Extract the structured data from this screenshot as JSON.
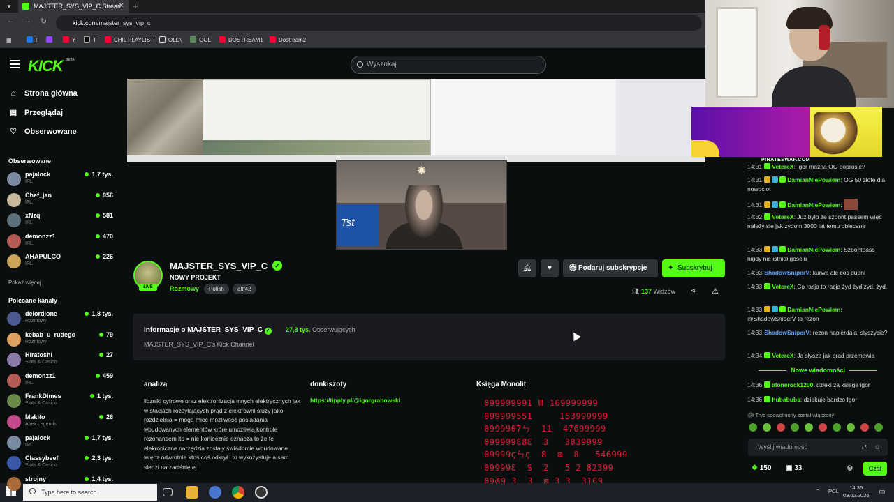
{
  "browser": {
    "tab_title": "MAJSTER_SYS_VIP_C Stream",
    "url_domain": "kick.com",
    "url_path": "/majster_sys_vip_c",
    "bookmarks": [
      "F",
      "",
      "Y",
      "T",
      "CHIL PLAYLIST",
      "OLD\\",
      "GOL",
      "DOSTREAM1",
      "Dostream2"
    ]
  },
  "header": {
    "logo": "KICK",
    "beta": "BETA",
    "search_placeholder": "Wyszukaj"
  },
  "nav": {
    "home": "Strona główna",
    "browse": "Przeglądaj",
    "following": "Obserwowane"
  },
  "sidebar": {
    "following_title": "Obserwowane",
    "show_more": "Pokaż więcej",
    "recommended_title": "Polecane kanały",
    "following": [
      {
        "name": "pajalock",
        "cat": "IRL",
        "viewers": "1,7 tys.",
        "color": "#7a8aa0"
      },
      {
        "name": "Chef_jan",
        "cat": "IRL",
        "viewers": "956",
        "color": "#c9b79a"
      },
      {
        "name": "xNzq",
        "cat": "IRL",
        "viewers": "581",
        "color": "#5d6f7a"
      },
      {
        "name": "demonzz1",
        "cat": "IRL",
        "viewers": "470",
        "color": "#b35b55"
      },
      {
        "name": "AHAPULCO",
        "cat": "IRL",
        "viewers": "226",
        "color": "#caa55a"
      }
    ],
    "recommended": [
      {
        "name": "delordione",
        "cat": "Rozmowy",
        "viewers": "1,8 tys.",
        "color": "#4d5a8f"
      },
      {
        "name": "kebab_u_rudego",
        "cat": "Rozmowy",
        "viewers": "79",
        "color": "#e0a060"
      },
      {
        "name": "Hiratoshi",
        "cat": "Slots & Casino",
        "viewers": "27",
        "color": "#8a7aa8"
      },
      {
        "name": "demonzz1",
        "cat": "IRL",
        "viewers": "459",
        "color": "#b35b55"
      },
      {
        "name": "FrankDimes",
        "cat": "Slots & Casino",
        "viewers": "1 tys.",
        "color": "#6a8a4a"
      },
      {
        "name": "Makito",
        "cat": "Apex Legends",
        "viewers": "26",
        "color": "#c24a8a"
      },
      {
        "name": "pajalock",
        "cat": "IRL",
        "viewers": "1,7 tys.",
        "color": "#7a8aa0"
      },
      {
        "name": "Classybeef",
        "cat": "Slots & Casino",
        "viewers": "2,3 tys.",
        "color": "#3a5aa8"
      },
      {
        "name": "strojny",
        "cat": "",
        "viewers": "1,4 tys.",
        "color": "#aa6a3a"
      }
    ]
  },
  "ad": {
    "label": "PIRATESWAP.COM"
  },
  "channel": {
    "name": "MAJSTER_SYS_VIP_C",
    "live": "LIVE",
    "stream_title": "NOWY PROJEKT",
    "category": "Rozmowy",
    "tags": [
      "Polish",
      "altf42"
    ],
    "gift_label": "Podaruj subskrypcje",
    "subscribe_label": "Subskrybuj",
    "viewers": "137",
    "viewers_label": "Widzów"
  },
  "about": {
    "title": "Informacje o MAJSTER_SYS_VIP_C",
    "followers": "27,3 tys.",
    "followers_label": "Obserwujących",
    "description": "MAJSTER_SYS_VIP_C's Kick Channel"
  },
  "panels": {
    "p1_title": "analiza",
    "p1_text": "liczniki cyfrowe oraz elektronizacja innych elektrycznych jak w stacjach rozsyłających prąd z elektrowni służy jako rozdzielnia = mogą mieć możliwość posiadania wbudowanych elementów króre umożliwią kontrole rezonansem itp = nie koniecznie oznacza to że te elekroniczne narzędzia zostały świadomie wbudowane wręcz odwrotnie ktoś coś odkrył i to wykożystuje a sam siedzi na zaciśniętej",
    "p2_title": "donkiszoty",
    "p2_link": "https://tipply.pl/@igorgrabowski",
    "p3_title": "Księga Monolit",
    "p3_lines": [
      "θ99999991 Ⅲ 169999999",
      "θ99999551     153999999",
      "θ9999θ7ㄣ  11  47699999",
      "θ99999Ɛ8Ɛ  3   3839999",
      "θ9999ϛㄣϛ  8  ⊠  8   546999",
      "θ9999Ɛ  S  2   5 2 82399",
      "θ9ᘔ9 3  3  ⊠ 3 3  3169"
    ]
  },
  "chat": {
    "messages": [
      {
        "t": "14:31",
        "u": "VetereX",
        "c": "g",
        "m": "Igor można OG poprosic?"
      },
      {
        "t": "14:31",
        "u": "DamianNiePowiem",
        "c": "g",
        "m": "OG 50 złote dla nowociot"
      },
      {
        "t": "14:31",
        "u": "DamianNiePowiem",
        "c": "g",
        "m": ""
      },
      {
        "t": "14:32",
        "u": "VetereX",
        "c": "g",
        "m": "Już było że szpont passem więc należy sie jak żydom 3000 lat temu obiecane"
      },
      {
        "t": "14:33",
        "u": "DamianNiePowiem",
        "c": "g",
        "m": "Szpontpass nigdy nie istniał gościu"
      },
      {
        "t": "14:33",
        "u": "ShadowSniperV",
        "c": "b",
        "m": "kurwa ale cos dudni"
      },
      {
        "t": "14:33",
        "u": "VetereX",
        "c": "g",
        "m": "Co racja to racja żyd żyd żyd. żyd."
      },
      {
        "t": "14:33",
        "u": "DamianNiePowiem",
        "c": "g",
        "m": "@ShadowSniperV to rezon"
      },
      {
        "t": "14:33",
        "u": "ShadowSniperV",
        "c": "b",
        "m": "rezon napierdala, slyszycie?"
      },
      {
        "t": "14:34",
        "u": "VetereX",
        "c": "g",
        "m": "Ja slysze jak prad przemawia"
      }
    ],
    "new_messages": "Nowe wiadomości",
    "messages2": [
      {
        "t": "14:36",
        "u": "alonerock1200",
        "c": "g",
        "m": "dzieki za ksiege igor"
      },
      {
        "t": "14:36",
        "u": "hubabubs",
        "c": "g",
        "m": "dziekuje bardzo Igor"
      }
    ],
    "slow_mode": "Tryb spowolniony został włączony",
    "input_placeholder": "Wyślij wiadomość",
    "points": "150",
    "gifts": "33",
    "chat_button": "Czat"
  },
  "taskbar": {
    "search": "Type here to search",
    "lang": "POL",
    "time": "14:36",
    "date": "03.02.2026"
  }
}
